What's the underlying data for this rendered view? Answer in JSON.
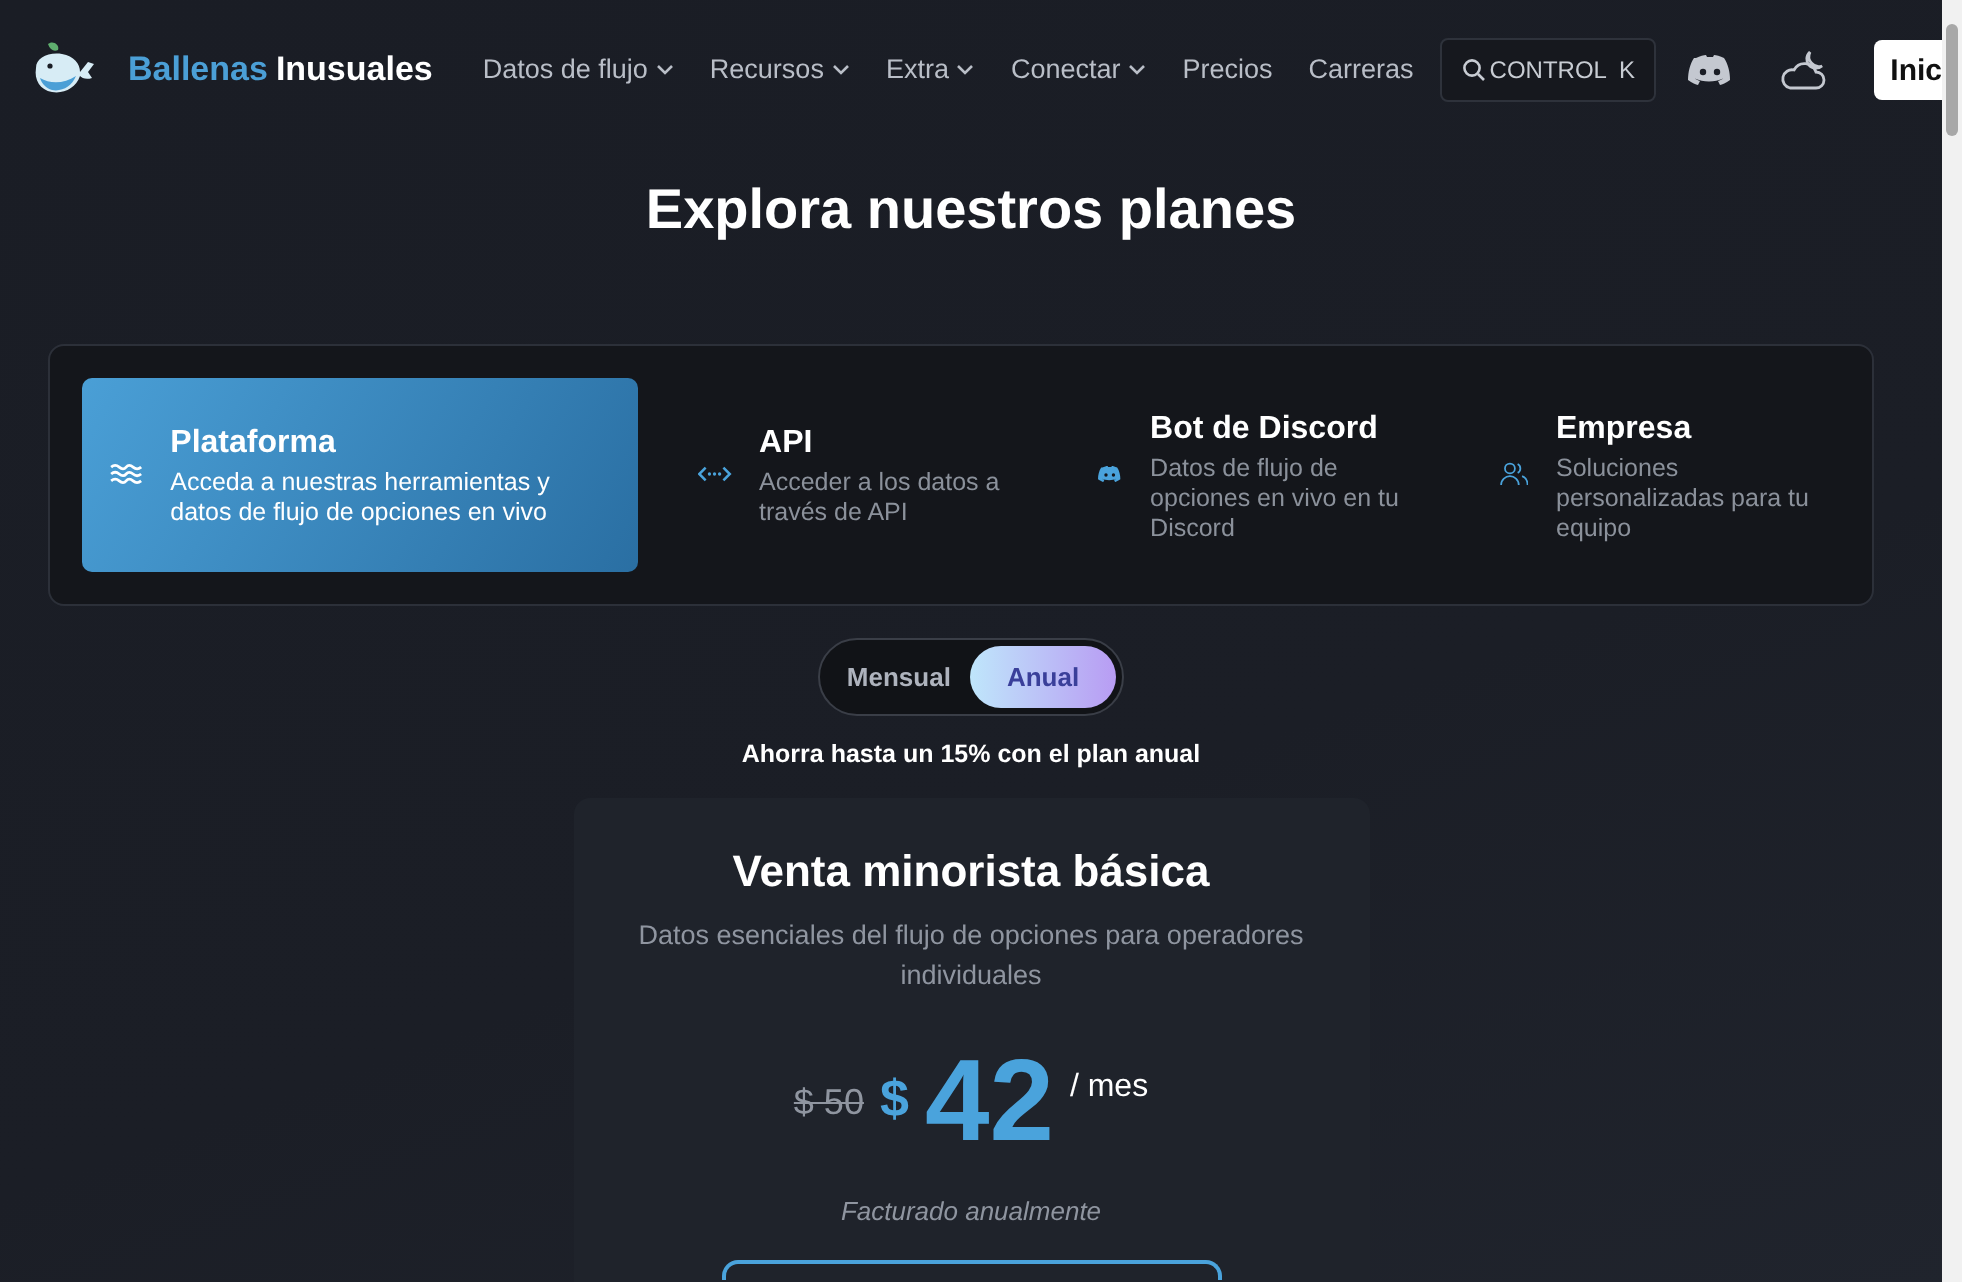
{
  "navbar": {
    "brand": {
      "part_1": "Ballenas",
      "part_2": "Inusuales"
    },
    "links": [
      {
        "label": "Datos de flujo",
        "dropdown": true
      },
      {
        "label": "Recursos",
        "dropdown": true
      },
      {
        "label": "Extra",
        "dropdown": true
      },
      {
        "label": "Conectar",
        "dropdown": true
      },
      {
        "label": "Precios",
        "dropdown": false
      },
      {
        "label": "Carreras",
        "dropdown": false
      }
    ],
    "search": {
      "key_1": "CONTROL",
      "key_2": "K"
    },
    "login_button": "Inic"
  },
  "heading": "Explora nuestros planes",
  "products": [
    {
      "kind": "waves",
      "title": "Plataforma",
      "description": "Acceda a nuestras herramientas y datos de flujo de opciones en vivo",
      "selected": true
    },
    {
      "kind": "api",
      "title": "API",
      "description": "Acceder a los datos a través de API",
      "selected": false
    },
    {
      "kind": "discord",
      "title": "Bot de Discord",
      "description": "Datos de flujo de opciones en vivo en tu Discord",
      "selected": false
    },
    {
      "kind": "team",
      "title": "Empresa",
      "description": "Soluciones personalizadas para tu equipo",
      "selected": false
    }
  ],
  "billing_toggle": [
    {
      "label": "Mensual",
      "selected": false
    },
    {
      "label": "Anual",
      "selected": true
    }
  ],
  "savings_note": "Ahorra hasta un 15% con el plan anual",
  "plan": {
    "name": "Venta minorista básica",
    "description": "Datos esenciales del flujo de opciones para operadores individuales",
    "old_price": "$ 50",
    "currency": "$",
    "price": "42",
    "period": "/ mes",
    "billing_note": "Facturado anualmente"
  }
}
